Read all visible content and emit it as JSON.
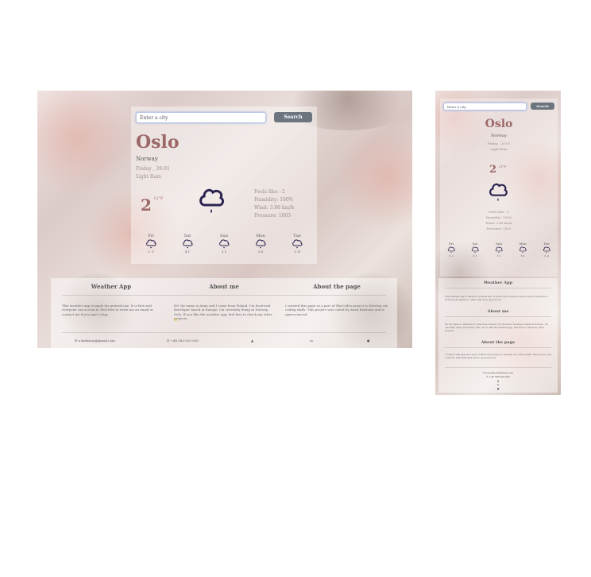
{
  "desktop": {
    "search_placeholder": "Enter a city",
    "search_button": "Search",
    "city": "Oslo",
    "country": "Norway",
    "date": "Friday , 20:01",
    "condition": "Light Rain",
    "temperature": "2",
    "units": "C|°F",
    "details": [
      "Feels like: -2",
      "Humidity: 100%",
      "Wind: 3.86 km/h",
      "Pressure: 1003"
    ],
    "forecast": [
      {
        "day": "Fri",
        "range": "3 -1"
      },
      {
        "day": "Sat",
        "range": "4 1"
      },
      {
        "day": "Sun",
        "range": "3 1"
      },
      {
        "day": "Mon",
        "range": "3 0"
      },
      {
        "day": "Tue",
        "range": "3 -4"
      }
    ],
    "sections": [
      {
        "title": "Weather App",
        "text": "This weather app is made for general use. It is free and everyone can access it. Feel free to write me an email or contact me if you spot a bug."
      },
      {
        "title": "About me",
        "text": "Hi! My name is Anna and I come from Poland. I'm front-end developer based in Europe. I'm currently living in Norway, Oslo. If you like the weather app, feel free to check my other projects."
      },
      {
        "title": "About the page",
        "text": "I created this page as a part of SheCodes project to develop my coding skills. This project was coded by Anna Kedziora and is open-sourced."
      }
    ],
    "footer": {
      "email": "a.kedziora@gmail.com",
      "phone": "+48 583 020 005"
    }
  },
  "mobile": {
    "search_placeholder": "Enter a city",
    "search_button": "Search",
    "city": "Oslo",
    "country": "Norway",
    "date": "Friday , 20:01",
    "condition": "Light Rain",
    "temperature": "2",
    "units": "C|°F",
    "details": [
      "Feels like: -2",
      "Humidity: 100%",
      "Wind: 3.86 km/h",
      "Pressure: 1003"
    ],
    "forecast": [
      {
        "day": "Fri",
        "range": "3 -1"
      },
      {
        "day": "Sat",
        "range": "4 1"
      },
      {
        "day": "Sun",
        "range": "3 1"
      },
      {
        "day": "Mon",
        "range": "3 0"
      },
      {
        "day": "Tue",
        "range": "3 -4"
      }
    ],
    "sections": [
      {
        "title": "Weather App",
        "text": "This weather app is made for general use. It is free and everyone can access it. Feel free to write me an email or contact me if you spot a bug."
      },
      {
        "title": "About me",
        "text": "Hi! My name is Anna and I come from Poland. I'm front-end developer based in Europe. I'm currently living in Norway, Oslo. If you like the weather app, feel free to check my other projects."
      },
      {
        "title": "About the page",
        "text": "I created this page as a part of SheCodes project to develop my coding skills. This project was coded by Anna Kedziora and is open-sourced."
      }
    ],
    "footer": {
      "email": "a.kedziora@gmail.com",
      "phone": "+48 583 020 005"
    }
  },
  "colors": {
    "accent": "#9c6868",
    "button": "#6c757d",
    "icon": "#2a2350"
  }
}
